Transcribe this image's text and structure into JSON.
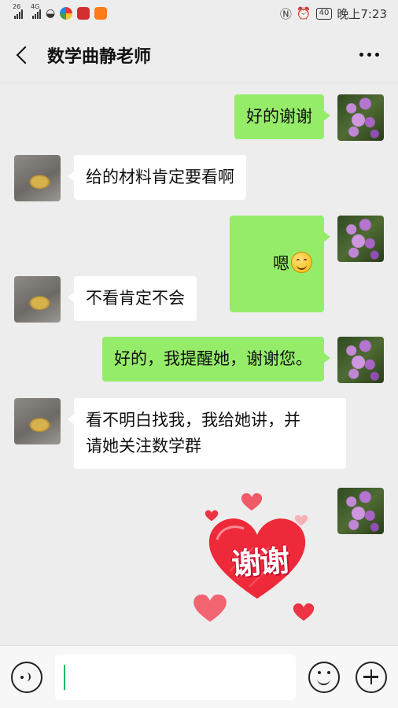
{
  "status_bar": {
    "signal1_label": "26",
    "signal2_label": "4G",
    "battery": "40",
    "time": "晚上7:23"
  },
  "nav": {
    "title": "数学曲静老师"
  },
  "messages": [
    {
      "sender": "me",
      "text": "好的谢谢"
    },
    {
      "sender": "them",
      "text": "给的材料肯定要看啊"
    },
    {
      "sender": "me",
      "text": "嗯",
      "emoji": "smiling-face-emoji"
    },
    {
      "sender": "them",
      "text": "不看肯定不会"
    },
    {
      "sender": "me",
      "text": "好的，我提醒她，谢谢您。"
    },
    {
      "sender": "them",
      "text": "看不明白找我，我给她讲，并\n请她关注数学群"
    },
    {
      "sender": "me",
      "sticker": "heart-sticker",
      "sticker_text": "谢谢"
    }
  ],
  "input_bar": {
    "value": "",
    "icons": [
      "voice-icon",
      "emoji-icon",
      "plus-icon"
    ]
  },
  "colors": {
    "my_bubble": "#95ec69",
    "their_bubble": "#ffffff",
    "background": "#ededed",
    "caret": "#07c160"
  }
}
